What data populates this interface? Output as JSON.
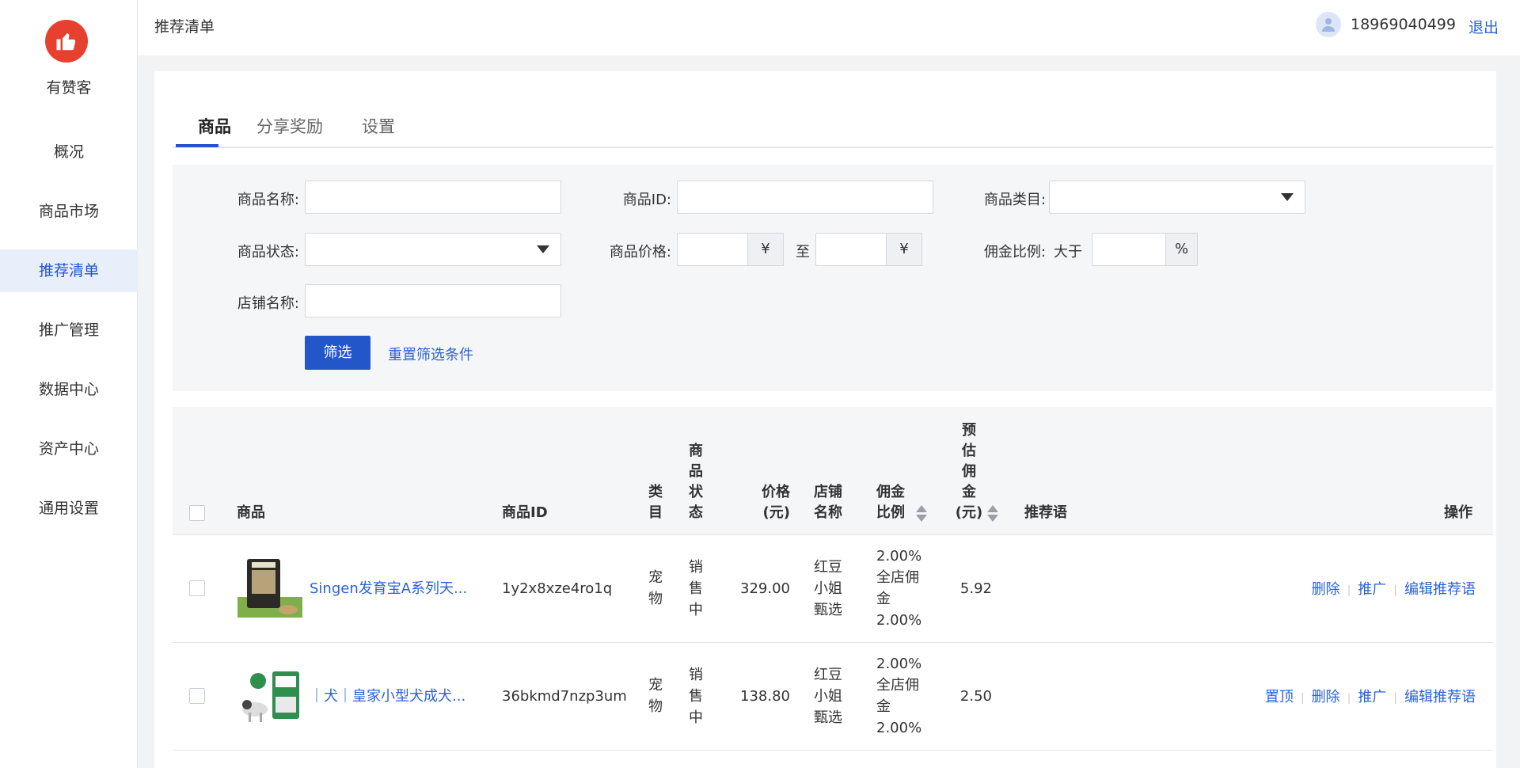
{
  "brand": {
    "name": "有赞客"
  },
  "sidebar": {
    "items": [
      {
        "label": "概况"
      },
      {
        "label": "商品市场"
      },
      {
        "label": "推荐清单"
      },
      {
        "label": "推广管理"
      },
      {
        "label": "数据中心"
      },
      {
        "label": "资产中心"
      },
      {
        "label": "通用设置"
      }
    ]
  },
  "header": {
    "title": "推荐清单",
    "phone": "18969040499",
    "logout": "退出"
  },
  "tabs": [
    {
      "label": "商品"
    },
    {
      "label": "分享奖励"
    },
    {
      "label": "设置"
    }
  ],
  "filter": {
    "name_label": "商品名称:",
    "id_label": "商品ID:",
    "category_label": "商品类目:",
    "status_label": "商品状态:",
    "price_label": "商品价格:",
    "currency": "¥",
    "to": "至",
    "commission_label": "佣金比例:",
    "greater_than": "大于",
    "percent": "%",
    "shop_label": "店铺名称:",
    "submit": "筛选",
    "reset": "重置筛选条件"
  },
  "table": {
    "headers": {
      "product": "商品",
      "product_id": "商品ID",
      "category": [
        "类",
        "目"
      ],
      "status": [
        "商",
        "品",
        "状",
        "态"
      ],
      "price": [
        "价格",
        "(元)"
      ],
      "shop": [
        "店铺",
        "名称"
      ],
      "commission": [
        "佣金",
        "比例"
      ],
      "est_commission": [
        "预",
        "估",
        "佣",
        "金",
        "(元)"
      ],
      "recommend": "推荐语",
      "actions": "操作"
    },
    "rows": [
      {
        "name": "Singen发育宝A系列天...",
        "id": "1y2x8xze4ro1q",
        "category": [
          "宠",
          "物"
        ],
        "status": [
          "销",
          "售",
          "中"
        ],
        "price": "329.00",
        "shop": [
          "红豆",
          "小姐",
          "甄选"
        ],
        "commission": "2.00%",
        "store_commission": [
          "全店佣",
          "金",
          "2.00%"
        ],
        "est": "5.92",
        "actions": [
          "删除",
          "推广",
          "编辑推荐语"
        ]
      },
      {
        "name": "｜犬｜皇家小型犬成犬...",
        "id": "36bkmd7nzp3um",
        "category": [
          "宠",
          "物"
        ],
        "status": [
          "销",
          "售",
          "中"
        ],
        "price": "138.80",
        "shop": [
          "红豆",
          "小姐",
          "甄选"
        ],
        "commission": "2.00%",
        "store_commission": [
          "全店佣",
          "金",
          "2.00%"
        ],
        "est": "2.50",
        "actions": [
          "置顶",
          "删除",
          "推广",
          "编辑推荐语"
        ]
      }
    ]
  },
  "colors": {
    "primary": "#2356c9",
    "link": "#2a63d6",
    "brand_red": "#e8402f",
    "active_nav_bg": "#e8effb"
  }
}
